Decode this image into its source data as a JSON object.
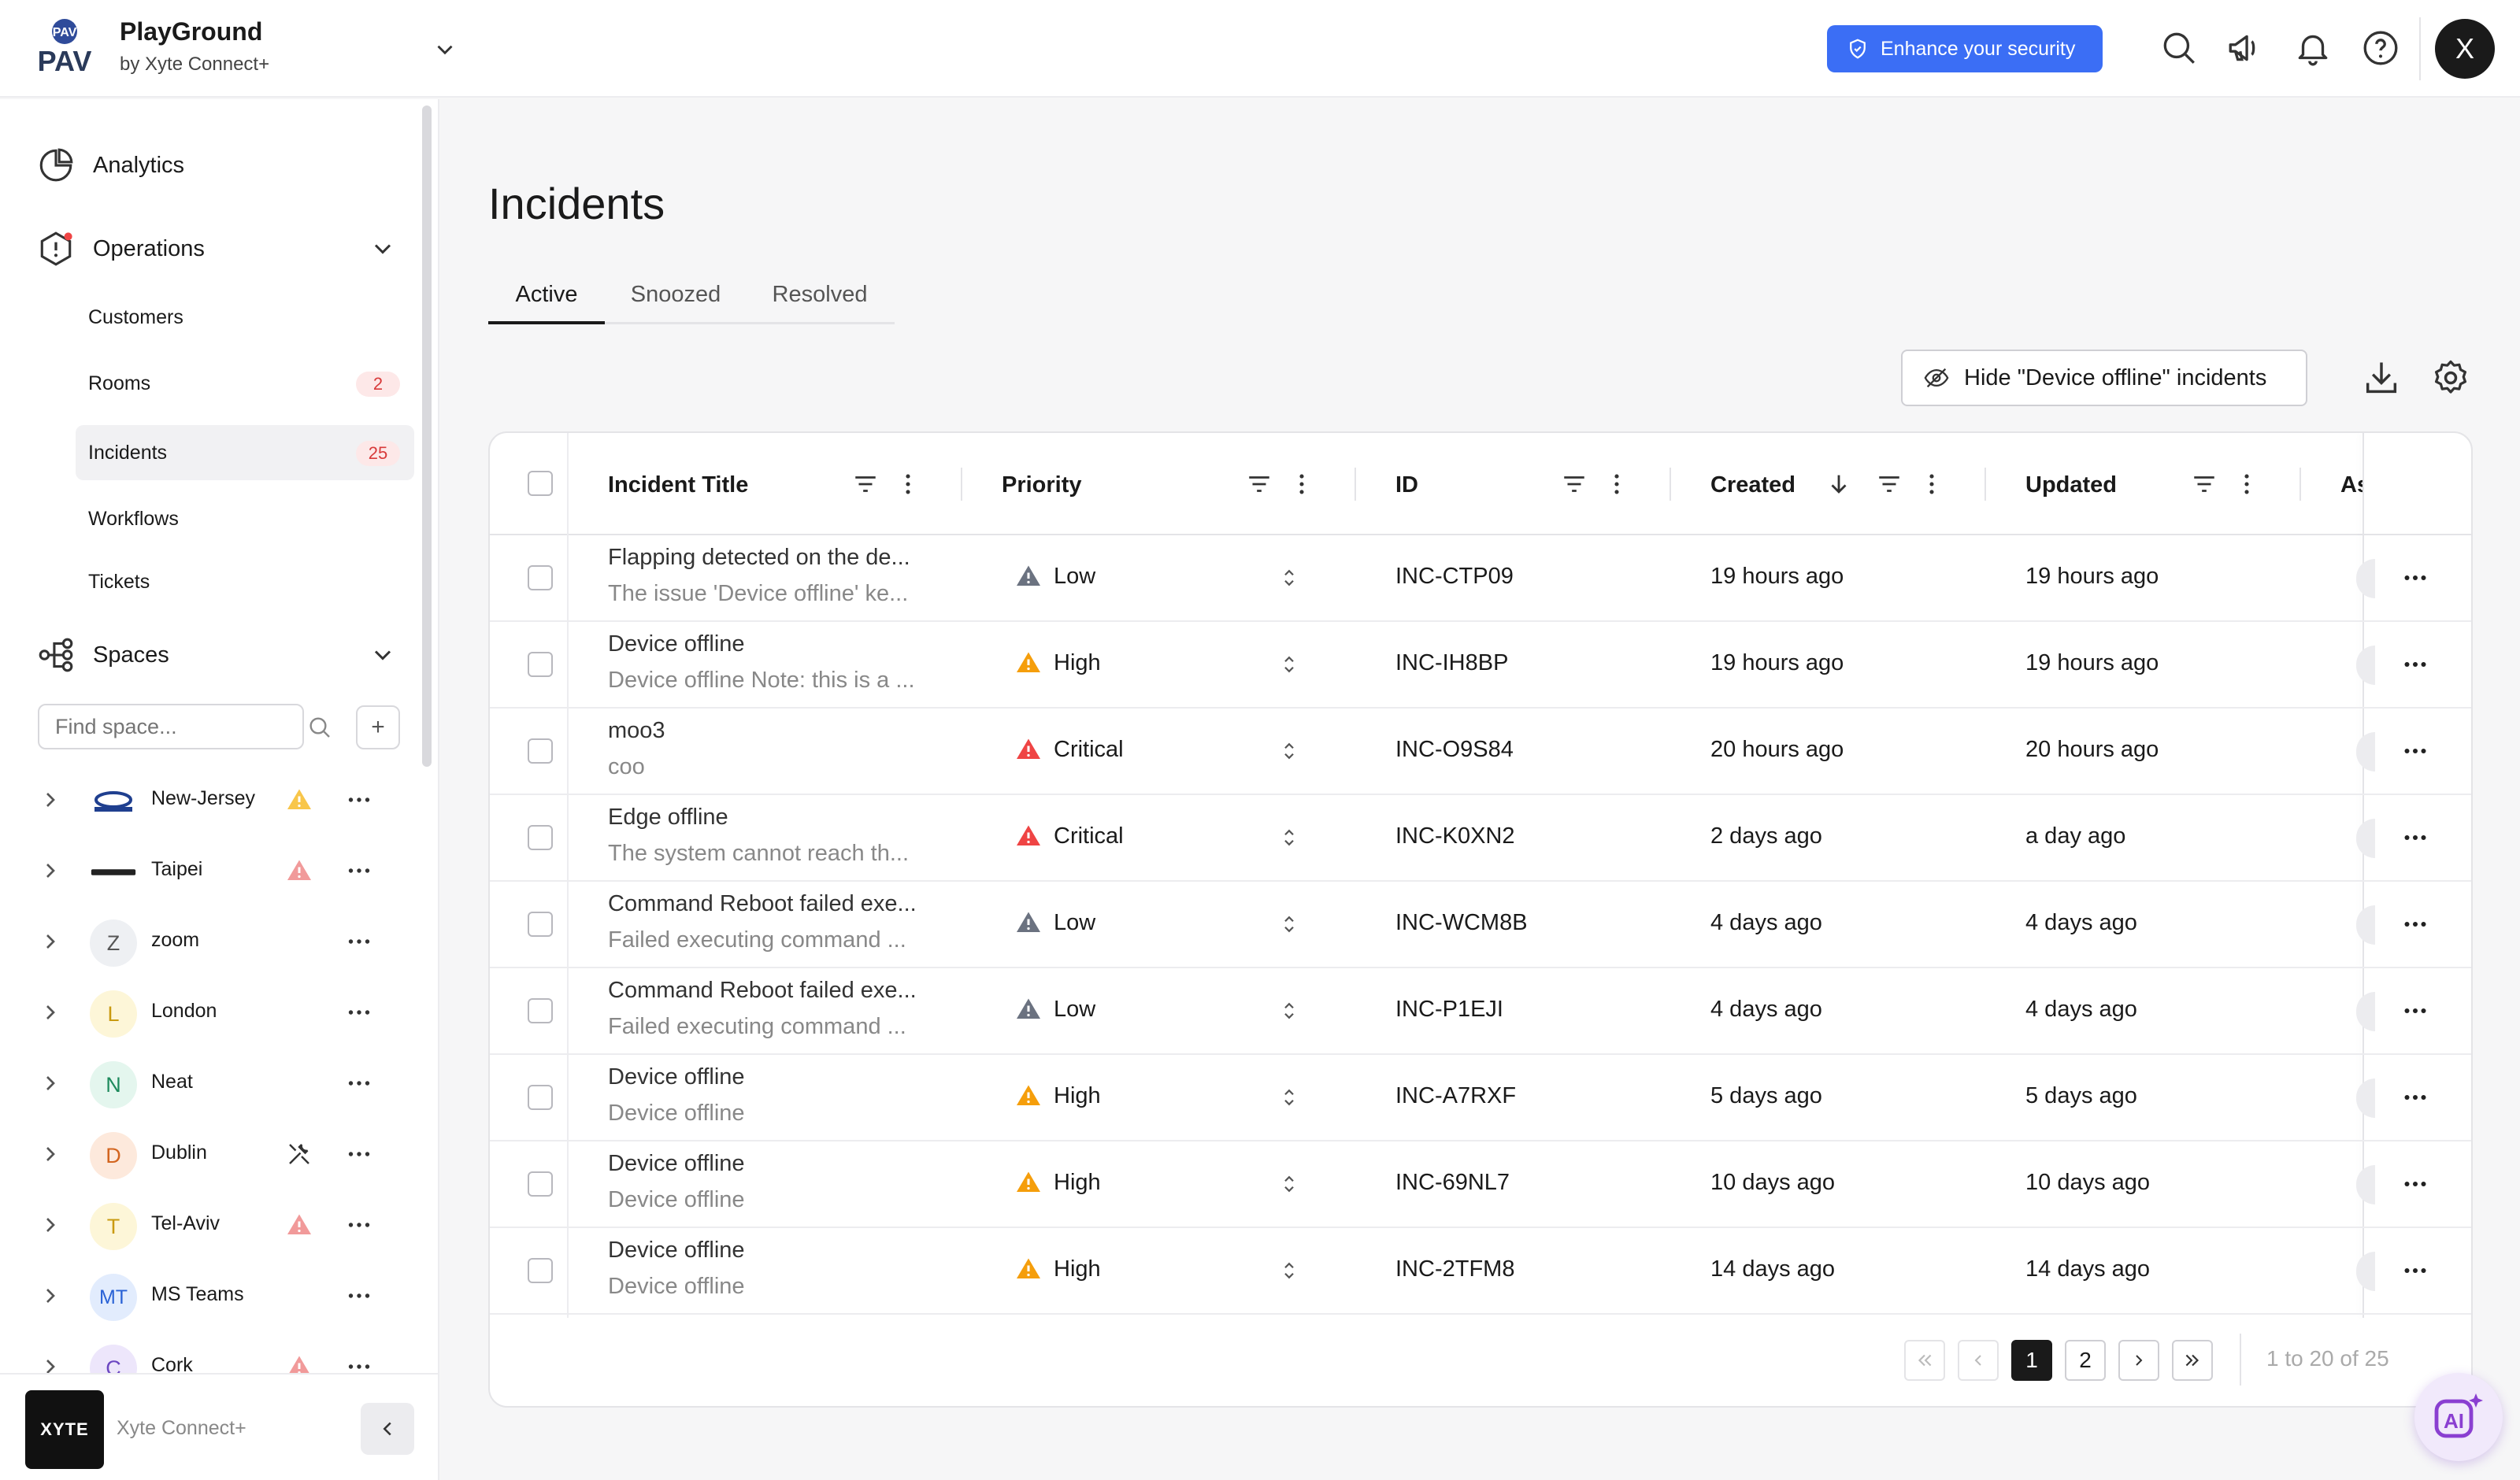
{
  "header": {
    "logo_top": "PAV",
    "logo_mark": "PAV",
    "org_name": "PlayGround",
    "org_sub": "by Xyte Connect+",
    "enhance_label": "Enhance your security",
    "avatar_letter": "X"
  },
  "sidebar": {
    "analytics_label": "Analytics",
    "operations_label": "Operations",
    "operations_items": [
      {
        "label": "Customers",
        "badge": ""
      },
      {
        "label": "Rooms",
        "badge": "2"
      },
      {
        "label": "Incidents",
        "badge": "25"
      },
      {
        "label": "Workflows",
        "badge": ""
      },
      {
        "label": "Tickets",
        "badge": ""
      }
    ],
    "spaces_label": "Spaces",
    "space_search_placeholder": "Find space...",
    "spaces": [
      {
        "name": "New-Jersey",
        "avatar": "CRESTRON",
        "status": "warning-yellow"
      },
      {
        "name": "Taipei",
        "avatar": "logitech",
        "status": "warning-red"
      },
      {
        "name": "zoom",
        "avatar": "Z",
        "status": ""
      },
      {
        "name": "London",
        "avatar": "L",
        "status": ""
      },
      {
        "name": "Neat",
        "avatar": "N",
        "status": ""
      },
      {
        "name": "Dublin",
        "avatar": "D",
        "status": "tools"
      },
      {
        "name": "Tel-Aviv",
        "avatar": "T",
        "status": "warning-red"
      },
      {
        "name": "MS Teams",
        "avatar": "MT",
        "status": ""
      },
      {
        "name": "Cork",
        "avatar": "C",
        "status": "warning-red"
      }
    ],
    "footer_logo": "XYTE",
    "footer_name": "Xyte Connect+"
  },
  "main": {
    "title": "Incidents",
    "tabs": [
      {
        "label": "Active",
        "active": true
      },
      {
        "label": "Snoozed",
        "active": false
      },
      {
        "label": "Resolved",
        "active": false
      }
    ],
    "hide_button_label": "Hide \"Device offline\" incidents",
    "columns": {
      "title": "Incident Title",
      "priority": "Priority",
      "id": "ID",
      "created": "Created",
      "updated": "Updated",
      "assignee": "As"
    },
    "rows": [
      {
        "title": "Flapping detected on the de...",
        "desc": "The issue 'Device offline' ke...",
        "priority": "Low",
        "id": "INC-CTP09",
        "created": "19 hours ago",
        "updated": "19 hours ago"
      },
      {
        "title": "Device offline",
        "desc": "Device offline Note: this is a ...",
        "priority": "High",
        "id": "INC-IH8BP",
        "created": "19 hours ago",
        "updated": "19 hours ago"
      },
      {
        "title": "moo3",
        "desc": "coo",
        "priority": "Critical",
        "id": "INC-O9S84",
        "created": "20 hours ago",
        "updated": "20 hours ago"
      },
      {
        "title": "Edge offline",
        "desc": "The system cannot reach th...",
        "priority": "Critical",
        "id": "INC-K0XN2",
        "created": "2 days ago",
        "updated": "a day ago"
      },
      {
        "title": "Command Reboot failed exe...",
        "desc": "Failed executing command ...",
        "priority": "Low",
        "id": "INC-WCM8B",
        "created": "4 days ago",
        "updated": "4 days ago"
      },
      {
        "title": "Command Reboot failed exe...",
        "desc": "Failed executing command ...",
        "priority": "Low",
        "id": "INC-P1EJI",
        "created": "4 days ago",
        "updated": "4 days ago"
      },
      {
        "title": "Device offline",
        "desc": "Device offline",
        "priority": "High",
        "id": "INC-A7RXF",
        "created": "5 days ago",
        "updated": "5 days ago"
      },
      {
        "title": "Device offline",
        "desc": "Device offline",
        "priority": "High",
        "id": "INC-69NL7",
        "created": "10 days ago",
        "updated": "10 days ago"
      },
      {
        "title": "Device offline",
        "desc": "Device offline",
        "priority": "High",
        "id": "INC-2TFM8",
        "created": "14 days ago",
        "updated": "14 days ago"
      }
    ],
    "pagination": {
      "pages": [
        "1",
        "2"
      ],
      "current": "1",
      "summary": "1 to 20 of 25"
    },
    "ai_label": "AI"
  },
  "colors": {
    "accent": "#3b6ef5",
    "low": "#6b7280",
    "high": "#f59e0b",
    "critical": "#ef4444",
    "badge_text": "#d83a3a",
    "badge_bg": "#fde8e8"
  }
}
